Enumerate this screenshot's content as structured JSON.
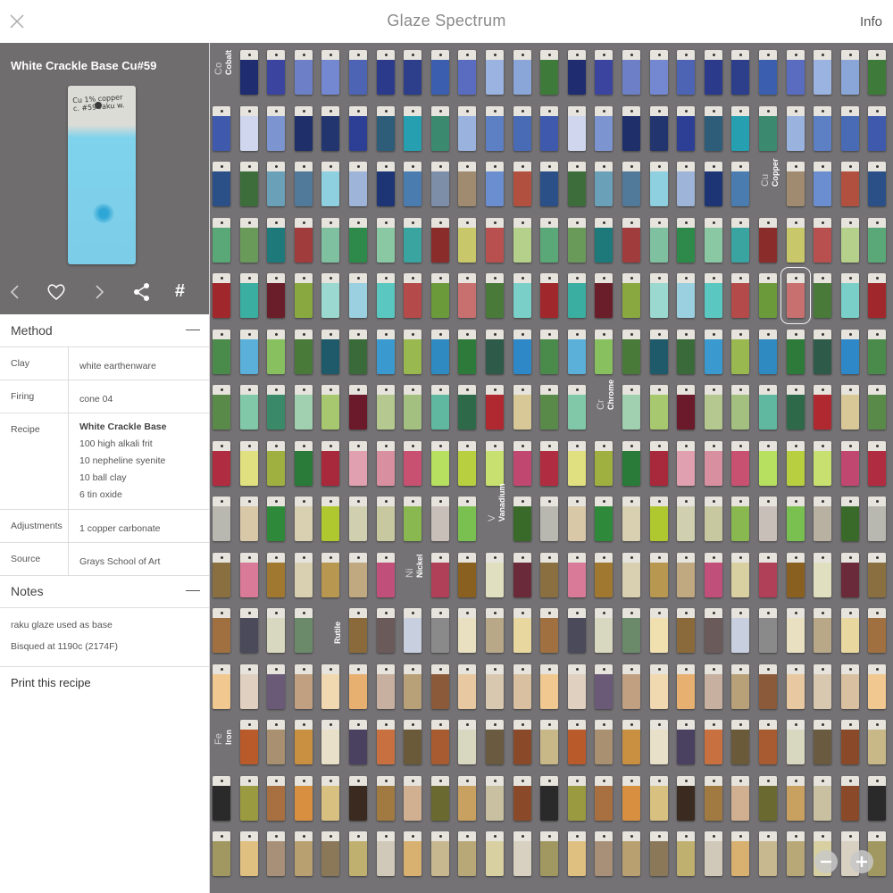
{
  "header": {
    "title": "Glaze Spectrum",
    "info_label": "Info"
  },
  "preview": {
    "title": "White Crackle Base Cu#59",
    "tile_note": "Cu 1% copper c. #59 raku w."
  },
  "method": {
    "heading": "Method",
    "rows": [
      {
        "key": "Clay",
        "lines": [
          "white earthenware"
        ]
      },
      {
        "key": "Firing",
        "lines": [
          "cone 04"
        ]
      },
      {
        "key": "Recipe",
        "lines": [
          "White Crackle Base",
          "100 high alkali frit",
          "10 nepheline syenite",
          "10 ball clay",
          "6 tin oxide"
        ]
      },
      {
        "key": "Adjustments",
        "lines": [
          "1 copper carbonate"
        ]
      },
      {
        "key": "Source",
        "lines": [
          "Grays School of Art"
        ]
      }
    ]
  },
  "notes": {
    "heading": "Notes",
    "items": [
      "raku glaze used as base",
      "Bisqued at 1190c (2174F)"
    ]
  },
  "print_label": "Print this recipe",
  "icons": [
    "close-icon",
    "chevron-left-icon",
    "heart-icon",
    "chevron-right-icon",
    "share-icon",
    "hash-icon",
    "zoom-out-icon",
    "zoom-in-icon"
  ],
  "elements": [
    {
      "symbol": "Co",
      "name": "Cobalt"
    },
    {
      "symbol": "Cu",
      "name": "Copper"
    },
    {
      "symbol": "Cr",
      "name": "Chrome"
    },
    {
      "symbol": "V",
      "name": "Vanadium"
    },
    {
      "symbol": "Ni",
      "name": "Nickel"
    },
    {
      "symbol": "",
      "name": "Rutile"
    },
    {
      "symbol": "Fe",
      "name": "Iron"
    }
  ],
  "colors": {
    "grid_bg": "#747274",
    "preview_bg": "#6f6d6e",
    "row_palettes": [
      [
        "#3e7a3a",
        "#2d3f8a",
        "#3b45a0",
        "#5a6cc0",
        "#7388d0",
        "#8aa6d8",
        "#2c3a8c",
        "#1f2d70",
        "#3b5fae",
        "#6d7fc6",
        "#9ab3e0",
        "#4d64b4"
      ],
      [
        "#1e2f6a",
        "#5d7fc4",
        "#2c3f95",
        "#3f5aad",
        "#26a0b0",
        "#7c94cf",
        "#9ab2de",
        "#23356f",
        "#496bb5",
        "#2e5d7a",
        "#cfd6ee",
        "#3b8a70"
      ],
      [
        "#1d3575",
        "#3d6d3a",
        "#7d8fa8",
        "#50799a",
        "#6a8ed0",
        "#9eb4d8",
        "#2b4f87",
        "#4a7cb0",
        "#6aa0b8",
        "#a08a70",
        "#8fd0e0",
        "#b25040"
      ],
      [
        "#c8c86a",
        "#7fc0a0",
        "#b4d08a",
        "#8ac8a4",
        "#6a9a5a",
        "#8a2c2a",
        "#a03c3c",
        "#b85050",
        "#2e8a4a",
        "#5aa878",
        "#3aa4a0",
        "#1e7a7a"
      ],
      [
        "#a0282c",
        "#b44a4a",
        "#6a1e2a",
        "#c87070",
        "#9ad8d0",
        "#7ad0c8",
        "#5ac8c0",
        "#3aaea0",
        "#6a9a3a",
        "#8aa840",
        "#4a7a3a",
        "#9ad0e0"
      ],
      [
        "#4a7a3a",
        "#2e5a4a",
        "#3a6a3a",
        "#4a8a4a",
        "#9ab850",
        "#88c060",
        "#2e7a3a",
        "#1e5a6a",
        "#2e88c8",
        "#3a9ad0",
        "#5ab0d8",
        "#2e8ac0"
      ],
      [
        "#b4c890",
        "#80c8a8",
        "#60b8a0",
        "#a0d0b0",
        "#b02830",
        "#6a1a2a",
        "#5a8a4a",
        "#a4c080",
        "#3a8a6a",
        "#2e6a4a",
        "#a8c870",
        "#d8c898"
      ],
      [
        "#b8d040",
        "#a8283c",
        "#c04870",
        "#d890a0",
        "#e0e080",
        "#b8e060",
        "#2a7a3a",
        "#c8e070",
        "#e0a0b0",
        "#b02c40",
        "#c85070",
        "#a0b040"
      ],
      [
        "#b8b8b0",
        "#8ab850",
        "#2e8a3a",
        "#7ac050",
        "#b0c830",
        "#3a6a2a",
        "#c8c8a0",
        "#d8c8a8",
        "#c8c0b8",
        "#d8d0b0",
        "#b8b0a0",
        "#d0d0b0"
      ],
      [
        "#d8d0b0",
        "#e0e0c0",
        "#c0a880",
        "#8a7040",
        "#d8d0a0",
        "#a07830",
        "#8a6020",
        "#b89850",
        "#6a2a3a",
        "#c0507a",
        "#d87a98",
        "#b04058"
      ],
      [
        "#6a5a5a",
        "#4a4a5a",
        "#8a8a8a",
        "#6a8a6a",
        "#b8a888",
        "#8a6a3a",
        "#a07040",
        "#c8d0e0",
        "#d8d8c0",
        "#e8e0c0",
        "#f0e0b0",
        "#e8d8a0"
      ],
      [
        "#e8c8a0",
        "#f0d8b0",
        "#d8c0a0",
        "#c8b0a0",
        "#e0d0c0",
        "#8a5a3a",
        "#c0a080",
        "#d8c8b0",
        "#e8b070",
        "#f0c890",
        "#b8a078",
        "#6a5a78"
      ],
      [
        "#c8b888",
        "#6a5a3a",
        "#a89070",
        "#d8d8c0",
        "#e8e0c8",
        "#8a4a2a",
        "#c87040",
        "#b85a2a",
        "#a85a30",
        "#c89040",
        "#6a5a40",
        "#4a4060"
      ],
      [
        "#d89040",
        "#c8c0a0",
        "#3a2a20",
        "#2a2a2a",
        "#d0b090",
        "#a87040",
        "#c8a060",
        "#d8c080",
        "#8a4a2a",
        "#a07a40",
        "#9a9a40",
        "#6a6a30"
      ],
      [
        "#d0c8b8",
        "#e0c080",
        "#c8b890",
        "#b8a070",
        "#d8d0a0",
        "#c0b070",
        "#a09860",
        "#d8b070",
        "#a89078",
        "#b8a878",
        "#8a7858",
        "#d8d0c0"
      ]
    ]
  }
}
